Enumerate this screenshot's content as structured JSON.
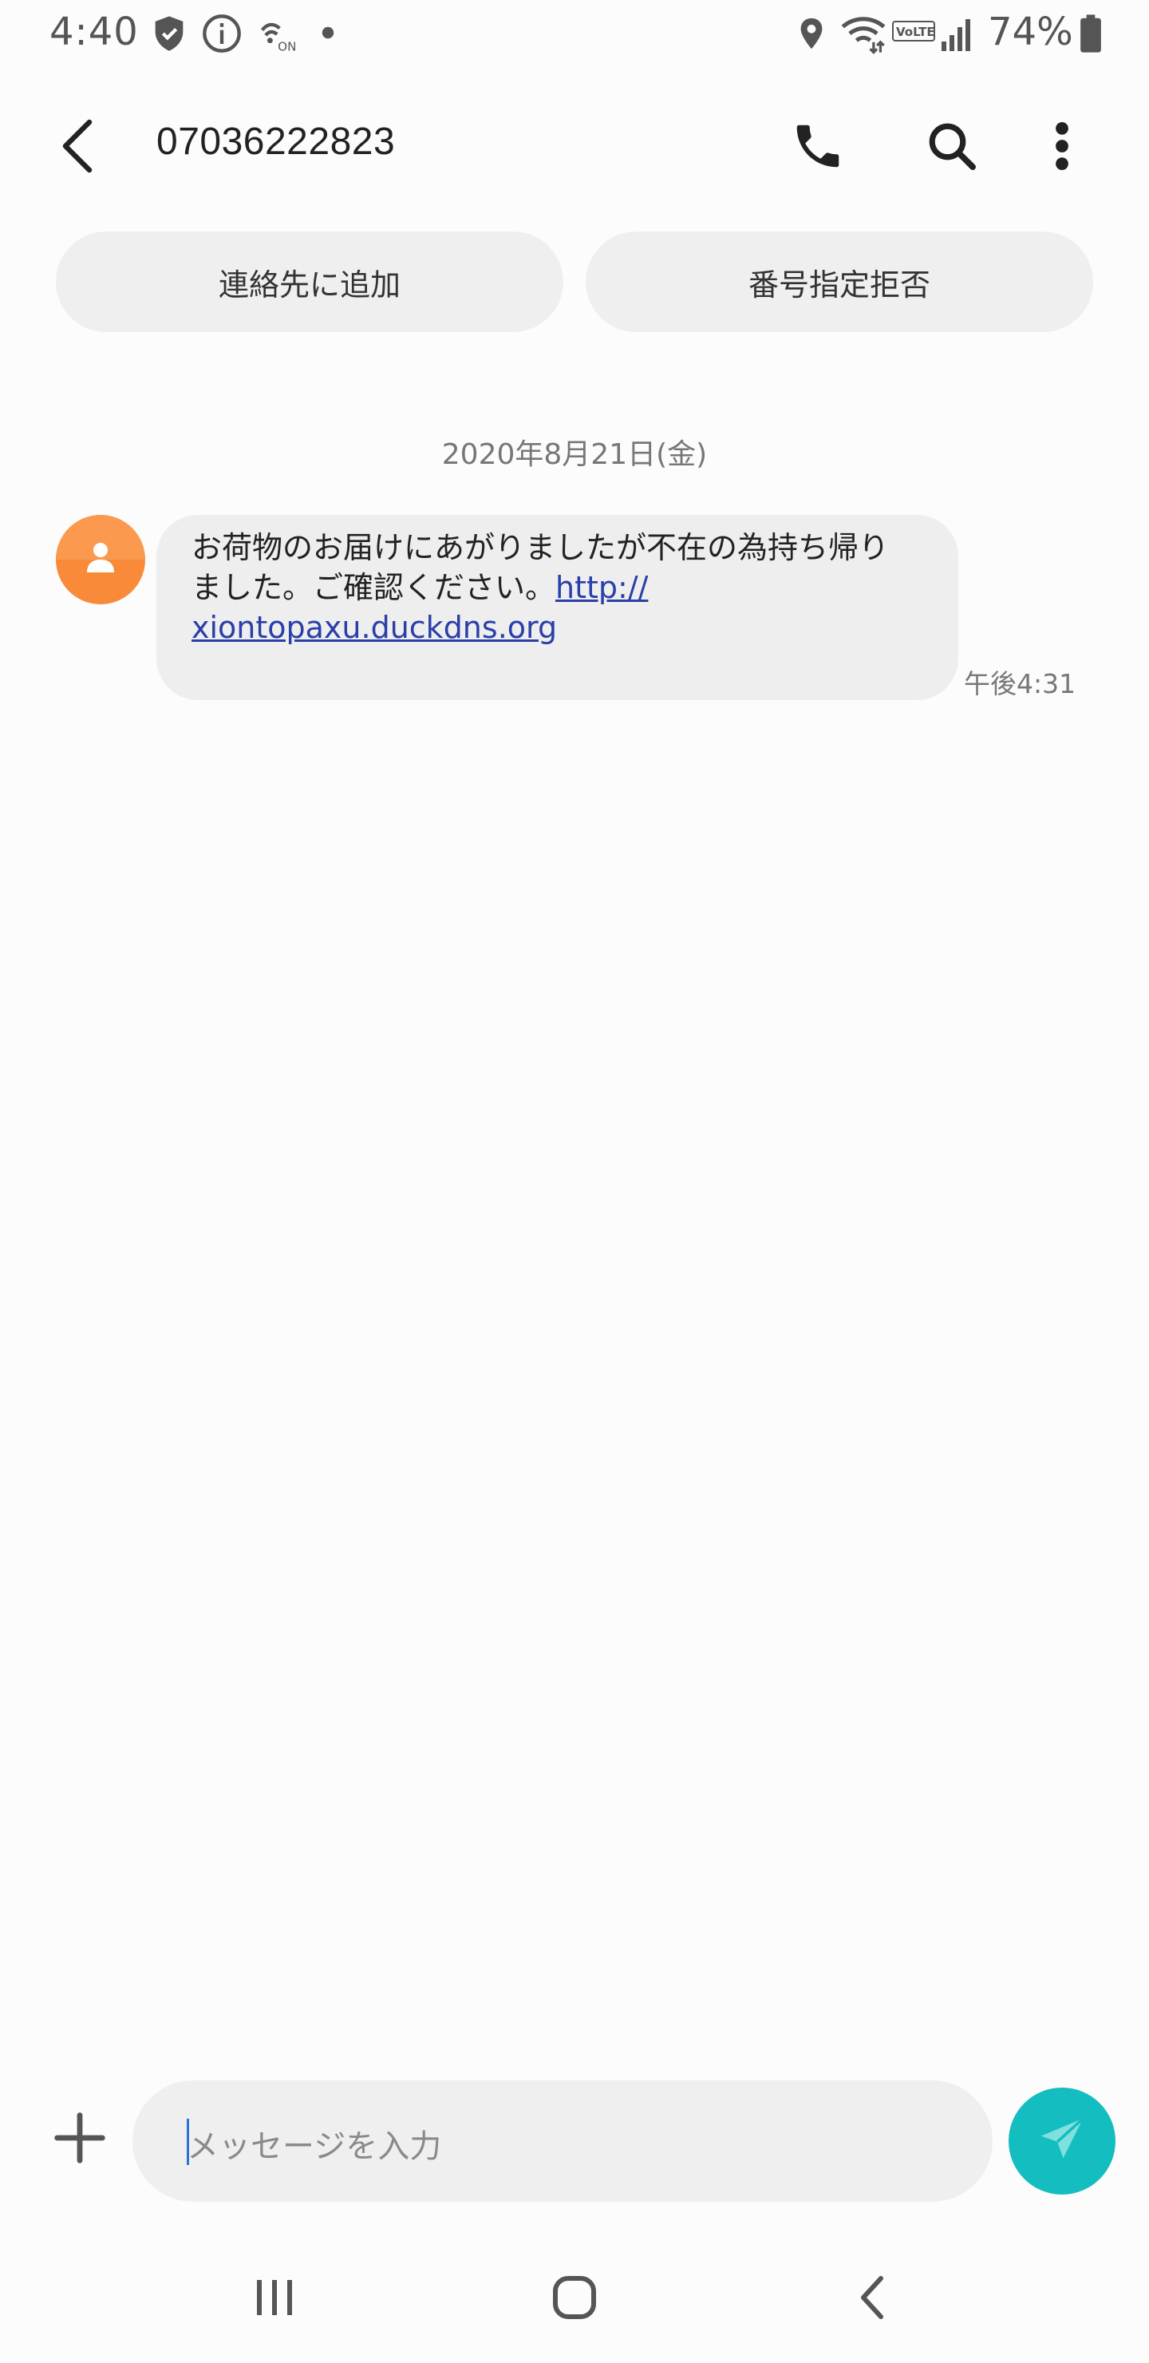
{
  "status_bar": {
    "time": "4:40",
    "battery_percent": "74%",
    "left_icons": [
      "shield-icon",
      "info-icon",
      "nfc-on-icon",
      "dot-icon"
    ],
    "right_icons": [
      "location-icon",
      "wifi-icon",
      "volte-icon",
      "signal-icon",
      "battery-icon"
    ]
  },
  "header": {
    "title": "07036222823",
    "actions": [
      "back-icon",
      "phone-icon",
      "search-icon",
      "more-vert-icon"
    ]
  },
  "quick_actions": {
    "add_contact": "連絡先に追加",
    "block_number": "番号指定拒否"
  },
  "conversation": {
    "date": "2020年8月21日(金)",
    "messages": [
      {
        "text_line1": "お荷物のお届けにあがりましたが不在の為持ち帰り",
        "text_line2_prefix": "ました。ご確認ください。",
        "link_part1": "http://",
        "link_part2": "xiontopaxu.duckdns.org",
        "time": "午後4:31"
      }
    ]
  },
  "composer": {
    "placeholder": "メッセージを入力"
  },
  "colors": {
    "accent_send": "#14bdc0",
    "avatar": "#f98a3a",
    "link": "#2a3fa8",
    "bubble": "#eeeeee"
  }
}
